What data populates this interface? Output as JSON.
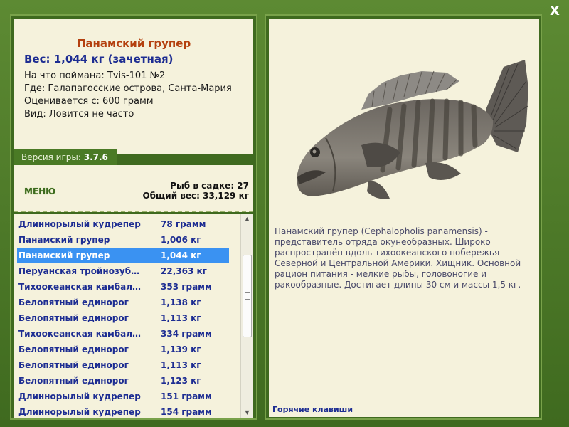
{
  "window": {
    "close_label": "X"
  },
  "fish_info": {
    "title": "Панамский групер",
    "weight": "Вес: 1,044 кг (зачетная)",
    "bait": "На что поймана: Tvis-101 №2",
    "location": "Где: Галапагосские острова, Санта-Мария",
    "rated_from": "Оценивается с: 600 грамм",
    "rarity": "Вид: Ловится не часто"
  },
  "version": {
    "label": "Версия игры: ",
    "value": "3.7.6"
  },
  "menu_label": "МЕНЮ",
  "stats": {
    "fish_in_keepnet": "Рыб в садке: 27",
    "total_weight": "Общий вес: 33,129 кг"
  },
  "catch_list": [
    {
      "name": "Длиннорылый кудрепер",
      "weight": "78 грамм"
    },
    {
      "name": "Панамский групер",
      "weight": "1,006 кг"
    },
    {
      "name": "Панамский групер",
      "weight": "1,044 кг",
      "selected": true
    },
    {
      "name": "Перуанская тройнозуб…",
      "weight": "22,363 кг"
    },
    {
      "name": "Тихоокеанская камбал…",
      "weight": "353 грамм"
    },
    {
      "name": "Белопятный единорог",
      "weight": "1,138 кг"
    },
    {
      "name": "Белопятный единорог",
      "weight": "1,113 кг"
    },
    {
      "name": "Тихоокеанская камбал…",
      "weight": "334 грамм"
    },
    {
      "name": "Белопятный единорог",
      "weight": "1,139 кг"
    },
    {
      "name": "Белопятный единорог",
      "weight": "1,113 кг"
    },
    {
      "name": "Белопятный единорог",
      "weight": "1,123 кг"
    },
    {
      "name": "Длиннорылый кудрепер",
      "weight": "151 грамм"
    },
    {
      "name": "Длиннорылый кудрепер",
      "weight": "154 грамм"
    }
  ],
  "description": "Панамский групер (Cephalopholis panamensis) - представитель отряда окунеобразных. Широко распространён вдоль тихоокеанского побережья Северной и Центральной Америки. Хищник. Основной рацион питания - мелкие рыбы, головоногие и ракообразные. Достигает длины 30 см и массы 1,5 кг.",
  "hotkeys_label": "Горячие клавиши",
  "colors": {
    "frame_green": "#3f6a1f",
    "panel_bg": "#f5f2dc",
    "title_orange": "#b4400f",
    "link_blue": "#1d2d92",
    "selection_blue": "#3a92f2"
  }
}
